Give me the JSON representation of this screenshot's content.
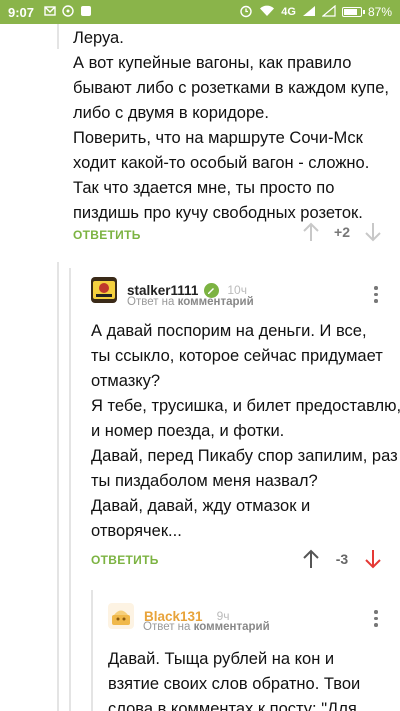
{
  "status_bar": {
    "time": "9:07",
    "network": "4G",
    "battery_percent": "87%",
    "battery_level": 0.87
  },
  "comment1": {
    "lines": [
      "Леруа.",
      "А вот купейные вагоны, как правило",
      "бывают либо с розетками в каждом купе,",
      "либо с двумя в коридоре.",
      "Поверить, что на маршруте Сочи-Мск",
      "ходит какой-то особый вагон - сложно.",
      "Так что здается мне, ты просто по",
      "пиздишь про кучу свободных розеток."
    ],
    "reply_label": "ОТВЕТИТЬ",
    "score": "+2"
  },
  "comment2": {
    "author": "stalker1111",
    "time": "10ч",
    "reply_prefix": "Ответ на",
    "reply_target": "комментарий",
    "lines": [
      "А давай поспорим на деньги. И все,",
      "ты ссыкло, которое сейчас придумает",
      "отмазку?",
      "Я тебе, трусишка, и билет предоставлю,",
      "и номер поезда, и фотки.",
      "Давай, перед Пикабу спор запилим, раз",
      "ты пиздаболом меня назвал?",
      "Давай, давай, жду отмазок и",
      "отворячек..."
    ],
    "reply_label": "ОТВЕТИТЬ",
    "score": "-3"
  },
  "comment3": {
    "author": "Black131",
    "time": "9ч",
    "reply_prefix": "Ответ на",
    "reply_target": "комментарий",
    "lines": [
      "Давай. Тыща рублей на кон и",
      "взятие своих слов обратно. Твои",
      "слова в комментах к посту: \"Для"
    ]
  },
  "colors": {
    "status_bar": "#8ab44a",
    "accent_green": "#7cb342",
    "downvote_red": "#e53935",
    "author_orange": "#e8a33a"
  }
}
